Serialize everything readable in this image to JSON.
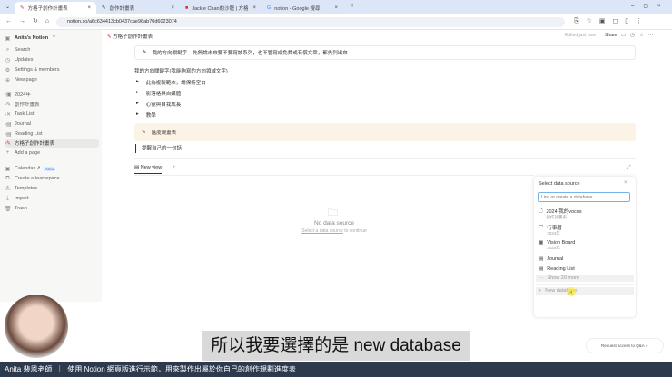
{
  "browser": {
    "tabs": [
      {
        "label": "方格子創作計畫表",
        "active": true
      },
      {
        "label": "創作計畫表"
      },
      {
        "label": "Jackie Chan的沙龍 | 方格子 -"
      },
      {
        "label": "notion - Google 搜尋"
      }
    ],
    "url": "notion.so/a6c634413cb0437cae96ab70d6023074"
  },
  "sidebar": {
    "workspace": "Anita's Notion",
    "top": [
      "Search",
      "Updates",
      "Settings & members",
      "New page"
    ],
    "pages": [
      "2024年",
      "創作計畫表",
      "Task List",
      "Journal",
      "Reading List",
      "方格子創作計畫表"
    ],
    "add_page": "Add a page",
    "bottom": [
      "Calendar ↗",
      "Create a teamspace",
      "Templates",
      "Import",
      "Trash"
    ],
    "new_badge": "New"
  },
  "header": {
    "breadcrumb": "方格子創作計畫表",
    "edited": "Edited just now",
    "share": "Share"
  },
  "content": {
    "callout1": "我的方向關鍵字 – 先無論未來要不要寫該系列，也不管寫成免費或有償文章，都先列出來",
    "heading": "我的方向關鍵字(我能夠寫的方向領域文字)",
    "toggles": [
      "此為複製範本，請保持空白",
      "影落格與自媒體",
      "心靈與自我成長",
      "教學"
    ],
    "callout2": "進度規畫表",
    "quote": "提醒自己的一句話",
    "view_tab": "New view",
    "empty_title": "No data source",
    "empty_link": "Select a data source",
    "empty_suffix": " to continue"
  },
  "panel": {
    "title": "Select data source",
    "placeholder": "Link or create a database...",
    "items": [
      {
        "label": "2024 我的vocus",
        "sub": "創作計畫表",
        "icon": "🗋"
      },
      {
        "label": "行事曆",
        "sub": "2024年",
        "icon": "▭"
      },
      {
        "label": "Vision Board",
        "sub": "2024年",
        "icon": "▦"
      },
      {
        "label": "Journal",
        "sub": "",
        "icon": "▤"
      },
      {
        "label": "Reading List",
        "sub": "",
        "icon": "▤"
      }
    ],
    "show_more": "Show 20 more",
    "new_db": "New database"
  },
  "overlay": {
    "caption": "所以我要選擇的是 new database",
    "request": "Request access to Q&A",
    "bottom_bar": "Anita 裴恩老師  ｜  使用 Notion 網頁版進行示範，用來製作出屬於你自己的創作規劃進度表"
  }
}
